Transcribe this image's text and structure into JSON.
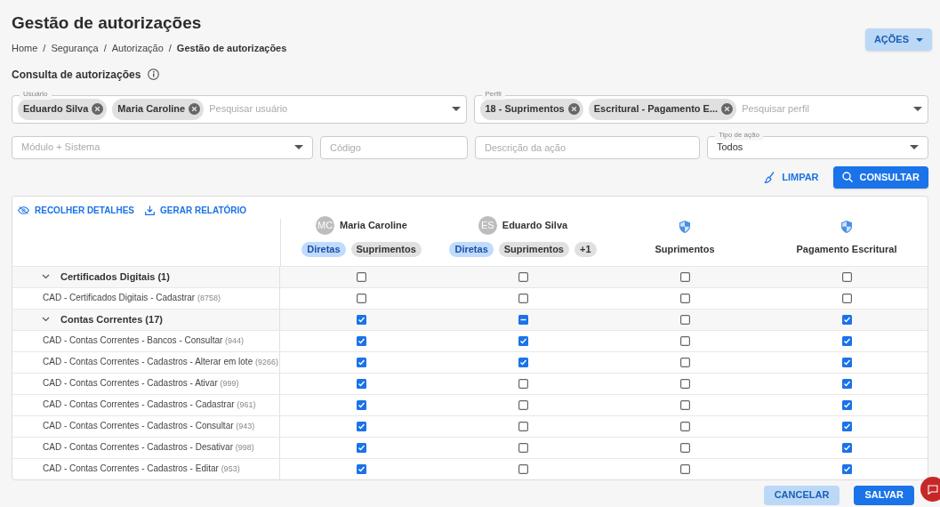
{
  "page": {
    "title": "Gestão de autorizações",
    "actions_button": "AÇÕES"
  },
  "breadcrumb_separator": "/",
  "breadcrumb": [
    {
      "label": "Home",
      "current": false
    },
    {
      "label": "Segurança",
      "current": false
    },
    {
      "label": "Autorização",
      "current": false
    },
    {
      "label": "Gestão de autorizações",
      "current": true
    }
  ],
  "section_title": "Consulta de autorizações",
  "filters": {
    "user": {
      "label": "Usuário",
      "chips": [
        "Eduardo Silva",
        "Maria Caroline"
      ],
      "placeholder": "Pesquisar usuário"
    },
    "profile": {
      "label": "Perfil",
      "chips": [
        "18 - Suprimentos",
        "Escritural - Pagamento E..."
      ],
      "placeholder": "Pesquisar perfil"
    },
    "module": {
      "placeholder": "Módulo + Sistema"
    },
    "code": {
      "placeholder": "Código"
    },
    "description": {
      "placeholder": "Descrição da ação"
    },
    "action_type": {
      "label": "Tipo de ação",
      "value": "Todos"
    },
    "clear_button": "LIMPAR",
    "search_button": "CONSULTAR"
  },
  "table": {
    "toolbar": [
      "RECOLHER DETALHES",
      "GERAR RELATÓRIO"
    ],
    "columns": [
      {
        "kind": "user",
        "initials": "MC",
        "name": "Maria Caroline",
        "tags": [
          {
            "label": "Diretas",
            "kind": "direct"
          },
          {
            "label": "Suprimentos",
            "kind": "profile"
          }
        ]
      },
      {
        "kind": "user",
        "initials": "ES",
        "name": "Eduardo Silva",
        "tags": [
          {
            "label": "Diretas",
            "kind": "direct"
          },
          {
            "label": "Suprimentos",
            "kind": "profile"
          },
          {
            "label": "+1",
            "kind": "more"
          }
        ]
      },
      {
        "kind": "profile",
        "name": "Suprimentos"
      },
      {
        "kind": "profile",
        "name": "Pagamento Escritural"
      }
    ],
    "rows": [
      {
        "kind": "group",
        "label": "Certificados Digitais (1)",
        "expanded": true,
        "cells": [
          {
            "checked": false,
            "indeterminate": false
          },
          {
            "checked": false,
            "indeterminate": false
          },
          {
            "checked": false,
            "indeterminate": false
          },
          {
            "checked": false,
            "indeterminate": false
          }
        ]
      },
      {
        "kind": "item",
        "label": "CAD - Certificados Digitais - Cadastrar",
        "code": "(8758)",
        "cells": [
          {
            "checked": false,
            "indeterminate": false
          },
          {
            "checked": false,
            "indeterminate": false
          },
          {
            "checked": false,
            "indeterminate": false
          },
          {
            "checked": false,
            "indeterminate": false
          }
        ]
      },
      {
        "kind": "group",
        "label": "Contas Correntes (17)",
        "expanded": true,
        "cells": [
          {
            "checked": true,
            "indeterminate": false
          },
          {
            "indeterminate": true
          },
          {
            "checked": false,
            "indeterminate": false
          },
          {
            "checked": true,
            "indeterminate": false
          }
        ]
      },
      {
        "kind": "item",
        "label": "CAD - Contas Correntes - Bancos - Consultar",
        "code": "(944)",
        "cells": [
          {
            "checked": true,
            "indeterminate": false
          },
          {
            "checked": true,
            "indeterminate": false
          },
          {
            "checked": false,
            "indeterminate": false
          },
          {
            "checked": true,
            "indeterminate": false
          }
        ]
      },
      {
        "kind": "item",
        "label": "CAD - Contas Correntes - Cadastros - Alterar em lote",
        "code": "(9266)",
        "cells": [
          {
            "checked": true,
            "indeterminate": false
          },
          {
            "checked": true,
            "indeterminate": false
          },
          {
            "checked": false,
            "indeterminate": false
          },
          {
            "checked": true,
            "indeterminate": false
          }
        ]
      },
      {
        "kind": "item",
        "label": "CAD - Contas Correntes - Cadastros - Ativar",
        "code": "(999)",
        "cells": [
          {
            "checked": true,
            "indeterminate": false
          },
          {
            "checked": false,
            "indeterminate": false
          },
          {
            "checked": false,
            "indeterminate": false
          },
          {
            "checked": true,
            "indeterminate": false
          }
        ]
      },
      {
        "kind": "item",
        "label": "CAD - Contas Correntes - Cadastros - Cadastrar",
        "code": "(961)",
        "cells": [
          {
            "checked": true,
            "indeterminate": false
          },
          {
            "checked": false,
            "indeterminate": false
          },
          {
            "checked": false,
            "indeterminate": false
          },
          {
            "checked": true,
            "indeterminate": false
          }
        ]
      },
      {
        "kind": "item",
        "label": "CAD - Contas Correntes - Cadastros - Consultar",
        "code": "(943)",
        "cells": [
          {
            "checked": true,
            "indeterminate": false
          },
          {
            "checked": false,
            "indeterminate": false
          },
          {
            "checked": false,
            "indeterminate": false
          },
          {
            "checked": true,
            "indeterminate": false
          }
        ]
      },
      {
        "kind": "item",
        "label": "CAD - Contas Correntes - Cadastros - Desativar",
        "code": "(998)",
        "cells": [
          {
            "checked": true,
            "indeterminate": false
          },
          {
            "checked": false,
            "indeterminate": false
          },
          {
            "checked": false,
            "indeterminate": false
          },
          {
            "checked": true,
            "indeterminate": false
          }
        ]
      },
      {
        "kind": "item",
        "label": "CAD - Contas Correntes - Cadastros - Editar",
        "code": "(953)",
        "cells": [
          {
            "checked": true,
            "indeterminate": false
          },
          {
            "checked": false,
            "indeterminate": false
          },
          {
            "checked": false,
            "indeterminate": false
          },
          {
            "checked": true,
            "indeterminate": false
          }
        ]
      }
    ]
  },
  "footer": {
    "cancel_button": "CANCELAR",
    "save_button": "SALVAR"
  }
}
